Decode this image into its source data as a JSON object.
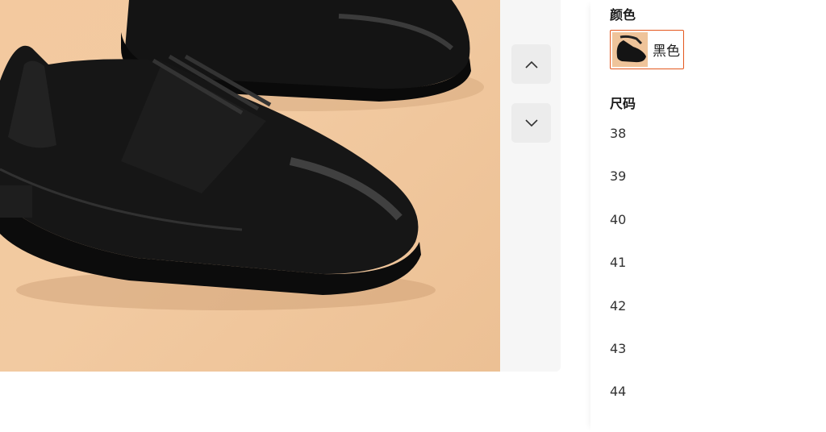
{
  "gallery": {
    "main_image_alt": "black leather derby shoes",
    "prev_icon": "chevron-up-icon",
    "next_icon": "chevron-down-icon"
  },
  "options": {
    "color_title": "颜色",
    "colors": [
      {
        "label": "黑色",
        "selected": true,
        "accent": "#e4571e"
      }
    ],
    "size_title": "尺码",
    "sizes": [
      "38",
      "39",
      "40",
      "41",
      "42",
      "43",
      "44"
    ]
  }
}
